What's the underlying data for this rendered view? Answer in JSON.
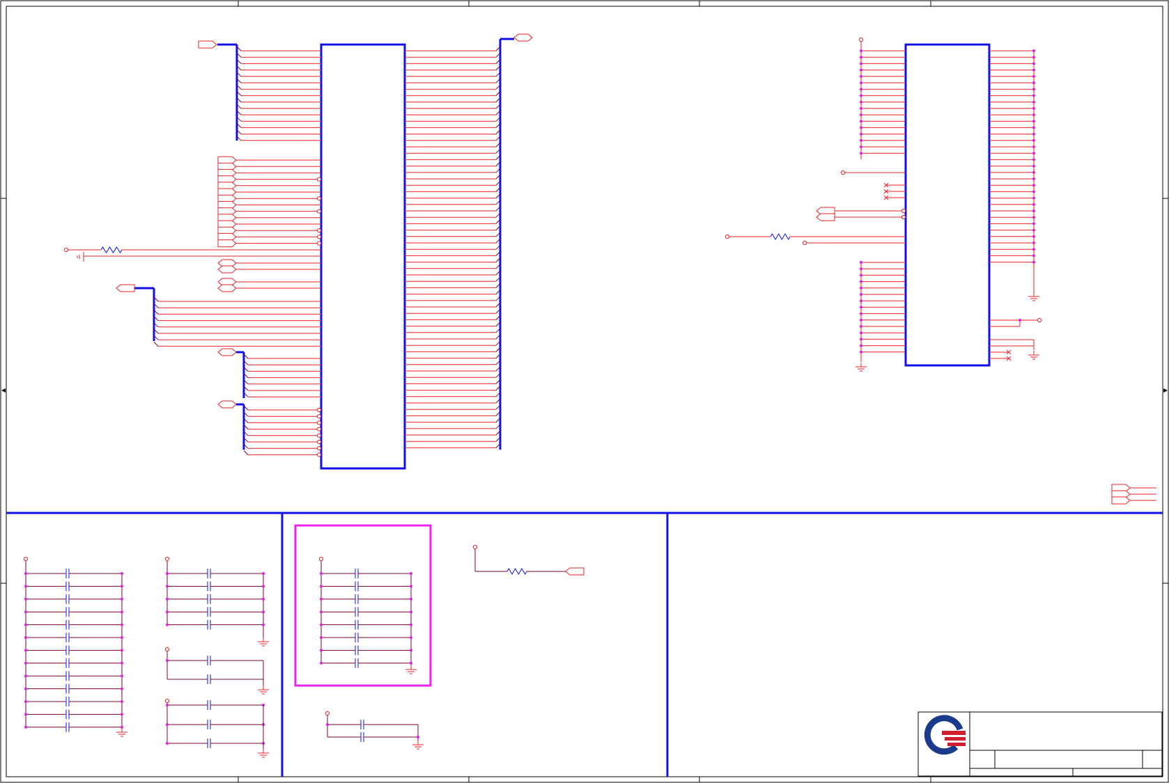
{
  "sheet": {
    "title": "",
    "zone_columns": [
      "",
      "",
      "",
      "",
      ""
    ],
    "zone_rows": [
      "",
      "",
      "",
      ""
    ]
  },
  "colors": {
    "wire": "#e8202a",
    "wire_dark": "#7a0030",
    "bus": "#1010e6",
    "component": "#1010e6",
    "junction": "#e020e0",
    "highlight_box": "#ee22ee",
    "frame": "#000000",
    "logo_blue": "#1a3a8c",
    "logo_red": "#d02030"
  },
  "symbols": [
    "connector-ic-left",
    "connector-ic-right",
    "resistor",
    "capacitor",
    "ground",
    "net-port",
    "no-connect",
    "power-pin",
    "company-logo"
  ],
  "title_block": {
    "company": "",
    "title": "",
    "doc_number": "",
    "rev": "",
    "size": "",
    "date": "",
    "sheet": ""
  }
}
